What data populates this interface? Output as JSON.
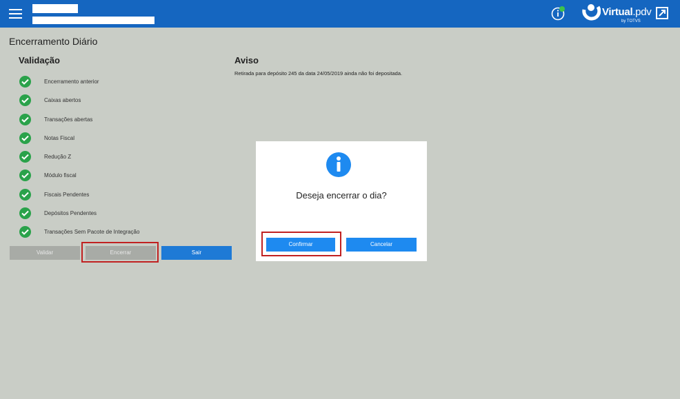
{
  "header": {
    "logo_name": "Virtual",
    "logo_suffix": ".pdv",
    "logo_by": "by TOTVS",
    "accent": "#1566c0"
  },
  "page": {
    "title": "Encerramento Diário"
  },
  "validation": {
    "title": "Validação",
    "items": [
      {
        "label": "Encerramento anterior",
        "status": "ok"
      },
      {
        "label": "Caixas abertos",
        "status": "ok"
      },
      {
        "label": "Transações abertas",
        "status": "ok"
      },
      {
        "label": "Notas Fiscal",
        "status": "ok"
      },
      {
        "label": "Redução Z",
        "status": "ok"
      },
      {
        "label": "Módulo fiscal",
        "status": "ok"
      },
      {
        "label": "Fiscais Pendentes",
        "status": "ok"
      },
      {
        "label": "Depósitos Pendentes",
        "status": "ok"
      },
      {
        "label": "Transações Sem Pacote de Integração",
        "status": "ok"
      }
    ],
    "buttons": {
      "validar": "Validar",
      "encerrar": "Encerrar",
      "sair": "Sair"
    }
  },
  "aviso": {
    "title": "Aviso",
    "message": "Retirada para depósito 245 da data 24/05/2019 ainda não foi depositada."
  },
  "dialog": {
    "icon": "info-icon",
    "message": "Deseja encerrar o dia?",
    "confirm_label": "Confirmar",
    "cancel_label": "Cancelar"
  }
}
